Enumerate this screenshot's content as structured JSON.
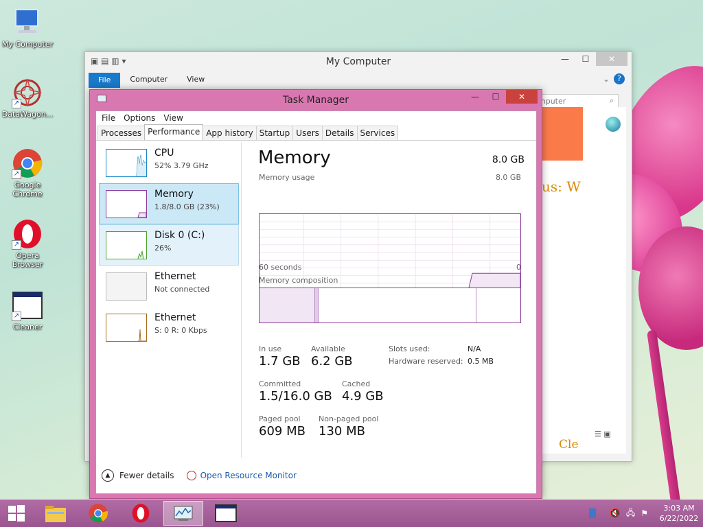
{
  "desktop": {
    "icons": [
      {
        "label": "My Computer"
      },
      {
        "label": "DataWagon..."
      },
      {
        "label": "Google Chrome"
      },
      {
        "label": "Opera Browser"
      },
      {
        "label": "Cleaner"
      }
    ]
  },
  "my_computer": {
    "title": "My Computer",
    "ribbon": {
      "file": "File",
      "computer": "Computer",
      "view": "View"
    },
    "search_placeholder": "Search Computer",
    "search_visible": "mputer",
    "content_snippets": {
      "text1": "us: W",
      "text2": "Cle"
    }
  },
  "task_manager": {
    "title": "Task Manager",
    "menu": [
      "File",
      "Options",
      "View"
    ],
    "tabs": [
      "Processes",
      "Performance",
      "App history",
      "Startup",
      "Users",
      "Details",
      "Services"
    ],
    "active_tab": "Performance",
    "resources": [
      {
        "name": "CPU",
        "sub": "52% 3.79 GHz",
        "color": "#1a88c8"
      },
      {
        "name": "Memory",
        "sub": "1.8/8.0 GB (23%)",
        "color": "#8b3a9b"
      },
      {
        "name": "Disk 0 (C:)",
        "sub": "26%",
        "color": "#4aa12a"
      },
      {
        "name": "Ethernet",
        "sub": "Not connected",
        "color": "#bbbbbb"
      },
      {
        "name": "Ethernet",
        "sub": "S: 0 R: 0 Kbps",
        "color": "#a86a1c"
      }
    ],
    "memory": {
      "title": "Memory",
      "total": "8.0 GB",
      "usage_label": "Memory usage",
      "usage_max": "8.0 GB",
      "time_left": "60 seconds",
      "time_right": "0",
      "usage_fraction": 0.23,
      "composition_label": "Memory composition",
      "in_use_label": "In use",
      "in_use": "1.7 GB",
      "available_label": "Available",
      "available": "6.2 GB",
      "committed_label": "Committed",
      "committed": "1.5/16.0 GB",
      "cached_label": "Cached",
      "cached": "4.9 GB",
      "paged_label": "Paged pool",
      "paged": "609 MB",
      "nonpaged_label": "Non-paged pool",
      "nonpaged": "130 MB",
      "slots_label": "Slots used:",
      "slots": "N/A",
      "hw_reserved_label": "Hardware reserved:",
      "hw_reserved": "0.5 MB"
    },
    "footer": {
      "fewer": "Fewer details",
      "monitor": "Open Resource Monitor"
    }
  },
  "taskbar": {
    "time": "3:03 AM",
    "date": "6/22/2022"
  }
}
